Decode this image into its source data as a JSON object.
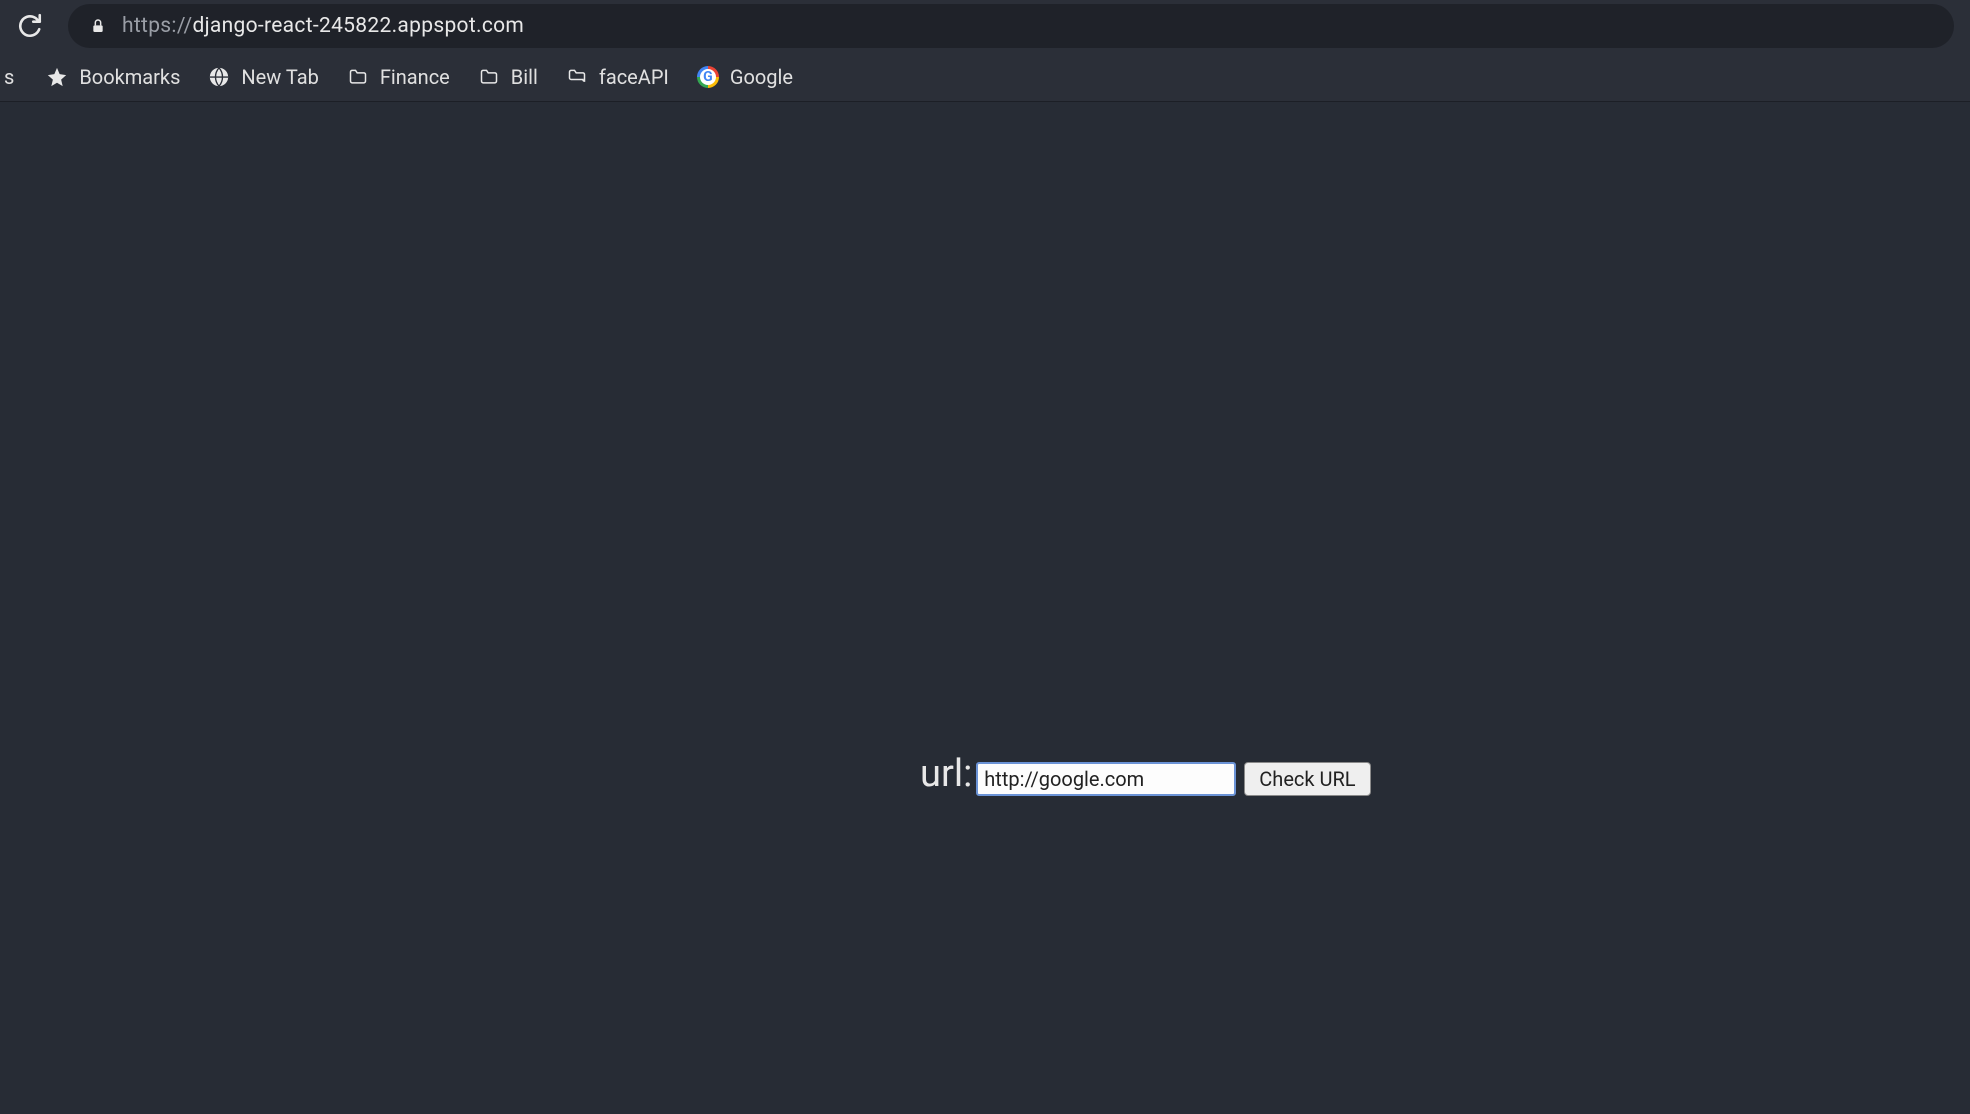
{
  "toolbar": {
    "url_protocol": "https://",
    "url_host": "django-react-245822.appspot.com"
  },
  "bookmarks": {
    "truncated_letter": "s",
    "items": [
      {
        "label": "Bookmarks",
        "icon": "star"
      },
      {
        "label": "New Tab",
        "icon": "globe"
      },
      {
        "label": "Finance",
        "icon": "folder"
      },
      {
        "label": "Bill",
        "icon": "folder"
      },
      {
        "label": "faceAPI",
        "icon": "folder"
      },
      {
        "label": "Google",
        "icon": "google"
      }
    ]
  },
  "page": {
    "url_label": "url:",
    "url_input_value": "http://google.com",
    "check_button_label": "Check URL"
  }
}
